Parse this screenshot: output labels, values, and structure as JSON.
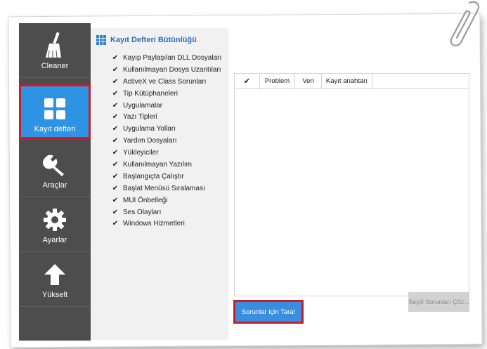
{
  "sidebar": {
    "items": [
      {
        "label": "Cleaner",
        "icon": "broom-icon",
        "active": false
      },
      {
        "label": "Kayıt defteri",
        "icon": "grid-icon",
        "active": true
      },
      {
        "label": "Araçlar",
        "icon": "wrench-icon",
        "active": false
      },
      {
        "label": "Ayarlar",
        "icon": "gear-icon",
        "active": false
      },
      {
        "label": "Yükselt",
        "icon": "arrow-up-icon",
        "active": false
      }
    ]
  },
  "options": {
    "title": "Kayıt Defteri Bütünlüğü",
    "check_mark": "✔",
    "items": [
      "Kayıp Paylaşılan DLL Dosyaları",
      "Kullanılmayan Dosya Uzantıları",
      "ActiveX ve Class Sorunları",
      "Tip Kütüphaneleri",
      "Uygulamalar",
      "Yazı Tipleri",
      "Uygulama Yolları",
      "Yardım Dosyaları",
      "Yükleyiciler",
      "Kullanılmayan Yazılım",
      "Başlangıçta Çalıştır",
      "Başlat Menüsü Sıralaması",
      "MUI Önbelleği",
      "Ses Olayları",
      "Windows Hizmetleri"
    ]
  },
  "table": {
    "select_all_mark": "✔",
    "columns": [
      "Problem",
      "Veri",
      "Kayıt anahtarı"
    ]
  },
  "buttons": {
    "scan": "Sorunlar için Tara!",
    "fix": "Seçili Sorunları Çöz..."
  },
  "colors": {
    "sidebar_bg": "#4d4d4d",
    "active_bg": "#2f93e3",
    "highlight": "#c81d2a",
    "primary_button": "#3a8ee0"
  }
}
